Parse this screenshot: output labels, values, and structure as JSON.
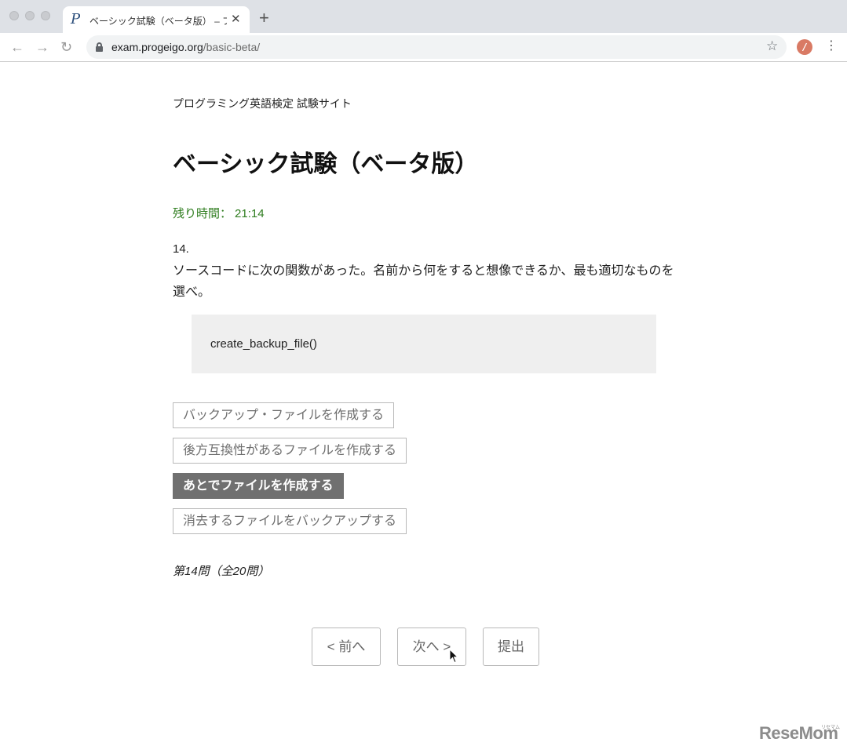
{
  "browser": {
    "tab_title": "ベーシック試験（ベータ版） – プロ",
    "url_host": "exam.progeigo.org",
    "url_path": "/basic-beta/",
    "favicon_letter": "P",
    "new_tab_label": "+",
    "close_glyph": "✕",
    "back_glyph": "←",
    "forward_glyph": "→",
    "reload_glyph": "↻",
    "star_glyph": "☆",
    "menu_glyph": "⋮",
    "extension_letter": "/"
  },
  "page": {
    "site_name": "プログラミング英語検定 試験サイト",
    "title": "ベーシック試験（ベータ版）",
    "timer_label": "残り時間：",
    "timer_value": "21:14",
    "question_number": "14.",
    "question_text": "ソースコードに次の関数があった。名前から何をすると想像できるか、最も適切なものを選べ。",
    "code": "create_backup_file()",
    "choices": [
      {
        "label": "バックアップ・ファイルを作成する",
        "selected": false
      },
      {
        "label": "後方互換性があるファイルを作成する",
        "selected": false
      },
      {
        "label": "あとでファイルを作成する",
        "selected": true
      },
      {
        "label": "消去するファイルをバックアップする",
        "selected": false
      }
    ],
    "progress_text": "第14問（全20問）",
    "prev_label": "< 前へ",
    "next_label": "次へ >",
    "submit_label": "提出"
  },
  "watermark": {
    "text": "ReseMom",
    "sub": "リセマム"
  },
  "colors": {
    "timer": "#2f7d1f",
    "selected_choice_bg": "#707070",
    "code_bg": "#efefef"
  }
}
